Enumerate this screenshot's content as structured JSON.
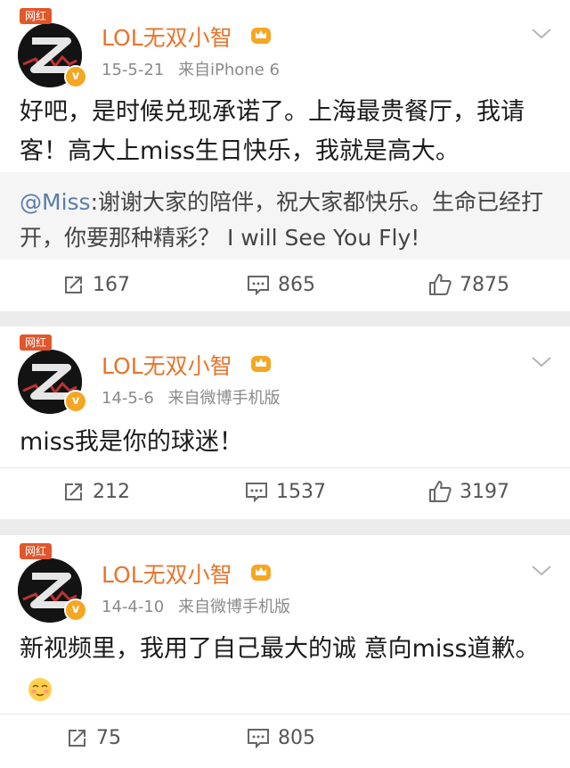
{
  "posts": [
    {
      "tag": "网红",
      "username": "LOL无双小智",
      "date": "15-5-21",
      "source": "来自iPhone 6",
      "content": "好吧，是时候兑现承诺了。上海最贵餐厅，我请客！高大上miss生日快乐，我就是高大。",
      "repost": {
        "author": "@Miss",
        "text": ":谢谢大家的陪伴，祝大家都快乐。生命已经打开，你要那种精彩？ I will See You Fly!"
      },
      "actions": {
        "share": "167",
        "comment": "865",
        "like": "7875"
      }
    },
    {
      "tag": "网红",
      "username": "LOL无双小智",
      "date": "14-5-6",
      "source": "来自微博手机版",
      "content": "miss我是你的球迷！",
      "actions": {
        "share": "212",
        "comment": "1537",
        "like": "3197"
      }
    },
    {
      "tag": "网红",
      "username": "LOL无双小智",
      "date": "14-4-10",
      "source": "来自微博手机版",
      "content": "新视频里，我用了自己最大的诚 意向miss道歉。",
      "emoji": "blush-emoji",
      "actions": {
        "share": "75",
        "comment": "805"
      }
    }
  ],
  "colors": {
    "username": "#e8742c",
    "meta": "#8a8a8a",
    "repost_author": "#5b7da8",
    "badge": "#f5a623",
    "tag": "#e2562b",
    "separator": "#ececec"
  },
  "icons": [
    "share-icon",
    "comment-icon",
    "like-icon",
    "chevron-down-icon",
    "crown-icon",
    "verified-badge-icon"
  ]
}
